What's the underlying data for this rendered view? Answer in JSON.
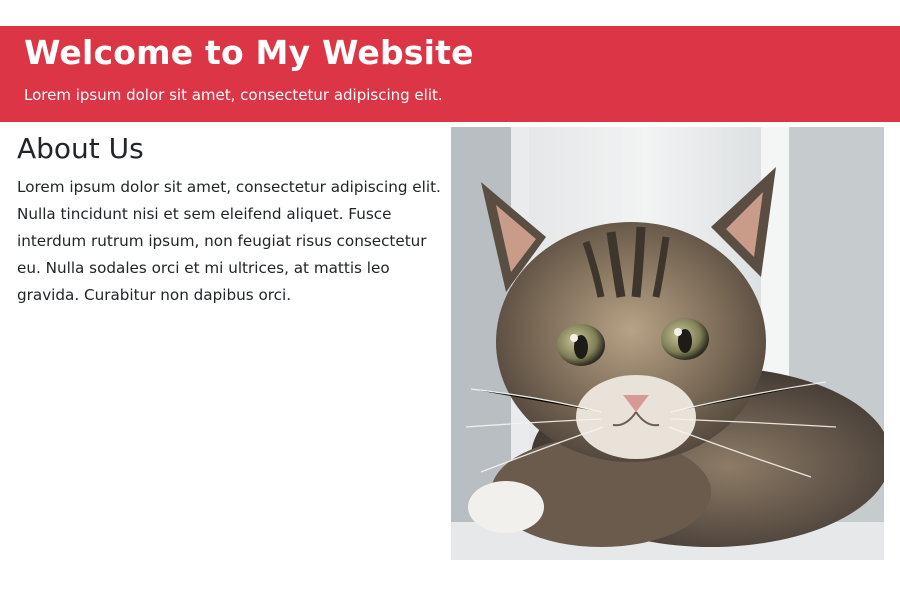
{
  "header": {
    "title": "Welcome to My Website",
    "subtitle": "Lorem ipsum dolor sit amet, consectetur adipiscing elit.",
    "background_color": "#dc3545"
  },
  "about": {
    "title": "About Us",
    "text": "Lorem ipsum dolor sit amet, consectetur adipiscing elit. Nulla tincidunt nisi et sem eleifend aliquet. Fusce interdum rutrum ipsum, non feugiat risus consectetur eu. Nulla sodales orci et mi ultrices, at mattis leo gravida. Curabitur non dapibus orci."
  },
  "image": {
    "icon": "kitten-photo"
  }
}
